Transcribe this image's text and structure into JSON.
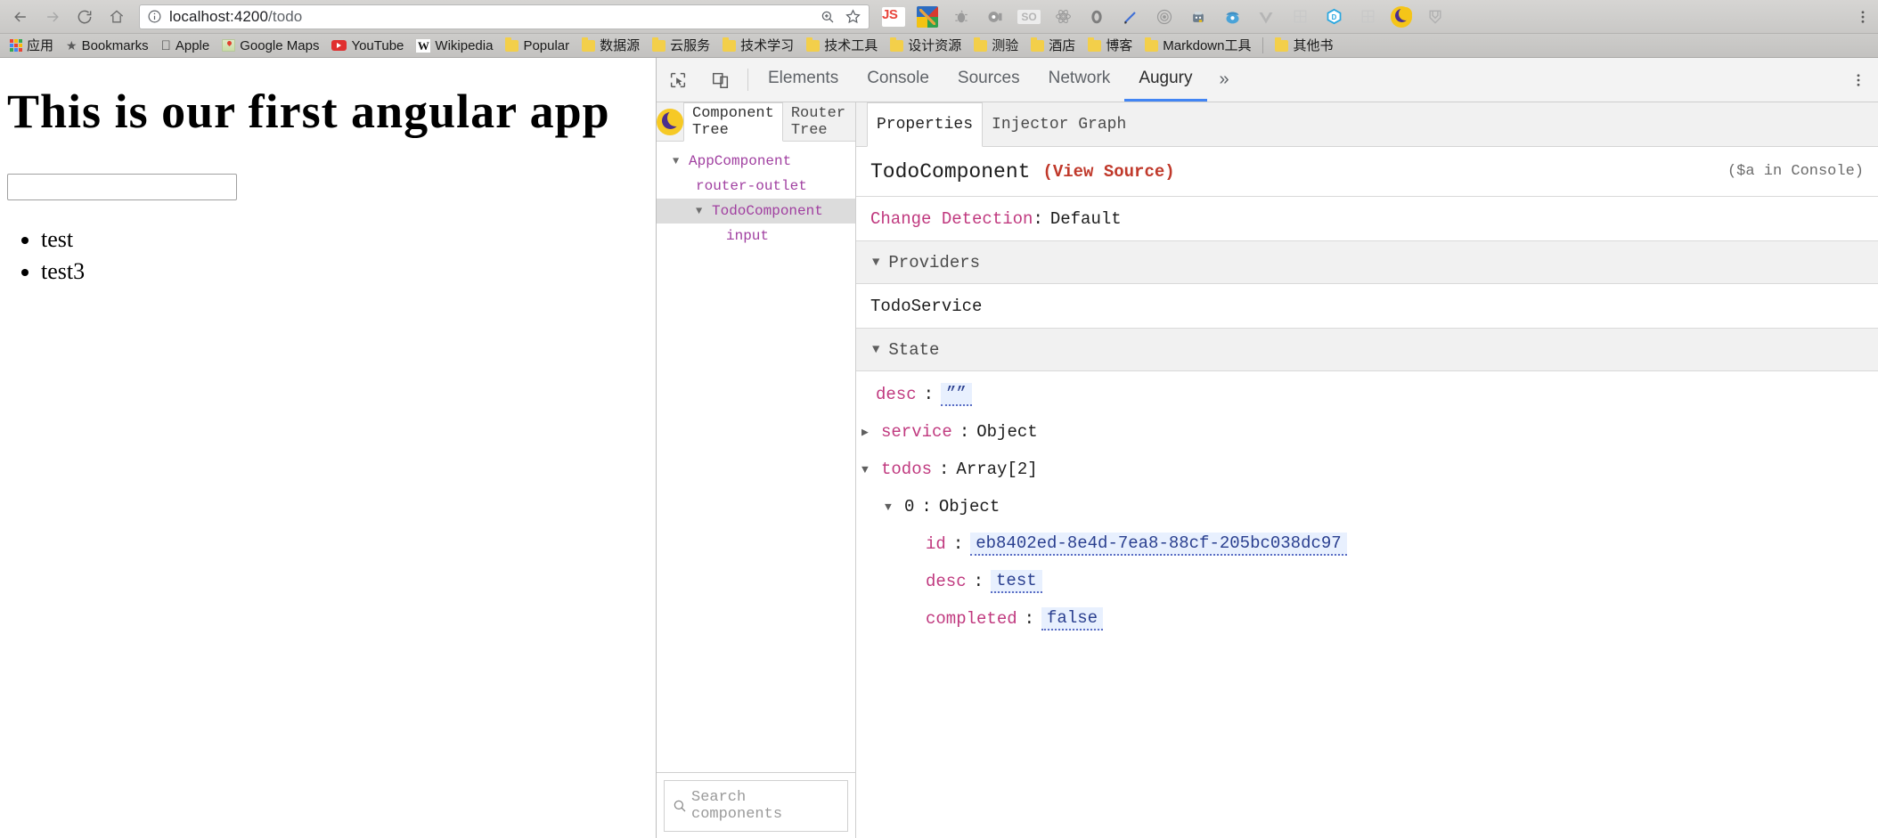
{
  "browser": {
    "nav": {
      "back": "back-arrow",
      "forward": "forward-arrow",
      "reload": "reload",
      "home": "home"
    },
    "url": {
      "host": "localhost:4200",
      "path": "/todo",
      "full": "localhost:4200/todo"
    },
    "omnibox_actions": [
      "zoom-icon",
      "bookmark-star-icon"
    ],
    "extensions": [
      "JS",
      "paint-icon",
      "bug-icon",
      "film-icon",
      "SO",
      "react-icon",
      "ring-icon",
      "pen-icon",
      "target-icon",
      "robot-icon",
      "detective-icon",
      "vue-icon",
      "grid-icon",
      "dimensions-icon",
      "grid2-icon",
      "moon-icon",
      "shield-icon"
    ],
    "menu": "chrome-menu-icon"
  },
  "bookmarks": [
    {
      "label": "应用",
      "icon": "apps-grid-icon"
    },
    {
      "label": "Bookmarks",
      "icon": "star-icon"
    },
    {
      "label": "Apple",
      "icon": "apple-icon"
    },
    {
      "label": "Google Maps",
      "icon": "map-icon"
    },
    {
      "label": "YouTube",
      "icon": "youtube-icon"
    },
    {
      "label": "Wikipedia",
      "icon": "wikipedia-icon"
    },
    {
      "label": "Popular",
      "icon": "folder-icon"
    },
    {
      "label": "数据源",
      "icon": "folder-icon"
    },
    {
      "label": "云服务",
      "icon": "folder-icon"
    },
    {
      "label": "技术学习",
      "icon": "folder-icon"
    },
    {
      "label": "技术工具",
      "icon": "folder-icon"
    },
    {
      "label": "设计资源",
      "icon": "folder-icon"
    },
    {
      "label": "测验",
      "icon": "folder-icon"
    },
    {
      "label": "酒店",
      "icon": "folder-icon"
    },
    {
      "label": "博客",
      "icon": "folder-icon"
    },
    {
      "label": "Markdown工具",
      "icon": "folder-icon"
    },
    {
      "label": "其他书",
      "icon": "folder-icon"
    }
  ],
  "page": {
    "heading": "This is our first angular app",
    "input_value": "",
    "input_placeholder": "",
    "todos": [
      "test",
      "test3"
    ]
  },
  "devtools": {
    "tabs": [
      {
        "label": "Elements",
        "active": false
      },
      {
        "label": "Console",
        "active": false
      },
      {
        "label": "Sources",
        "active": false
      },
      {
        "label": "Network",
        "active": false
      },
      {
        "label": "Augury",
        "active": true
      }
    ],
    "more": "»",
    "tools": [
      "inspect-element-icon",
      "device-toolbar-icon"
    ],
    "menu": "kebab-menu-icon"
  },
  "augury": {
    "logo": "augury-moon-logo",
    "tree_tabs": [
      {
        "label": "Component Tree",
        "active": true
      },
      {
        "label": "Router Tree",
        "active": false
      }
    ],
    "tree": [
      {
        "label": "AppComponent",
        "caret": "▼",
        "depth": 0,
        "selected": false
      },
      {
        "label": "router-outlet",
        "caret": "",
        "depth": 1,
        "selected": false
      },
      {
        "label": "TodoComponent",
        "caret": "▼",
        "depth": 1,
        "selected": true
      },
      {
        "label": "input",
        "caret": "",
        "depth": 2,
        "selected": false
      }
    ],
    "search": {
      "placeholder": "Search components",
      "icon": "search-icon"
    },
    "prop_tabs": [
      {
        "label": "Properties",
        "active": true
      },
      {
        "label": "Injector Graph",
        "active": false
      }
    ],
    "component": {
      "name": "TodoComponent",
      "view_source": "(View Source)",
      "console_hint": "($a in Console)"
    },
    "change_detection": {
      "key": "Change Detection",
      "sep": ":",
      "value": "Default"
    },
    "providers": {
      "title": "Providers",
      "caret": "▼",
      "items": [
        "TodoService"
      ]
    },
    "state": {
      "title": "State",
      "caret": "▼",
      "rows": [
        {
          "caret": "",
          "key": "desc",
          "sep": ":",
          "value": "””",
          "chip": true,
          "depth": 1
        },
        {
          "caret": "▶",
          "key": "service",
          "sep": ":",
          "value": "Object",
          "chip": false,
          "depth": 0
        },
        {
          "caret": "▼",
          "key": "todos",
          "sep": ":",
          "value": "Array[2]",
          "chip": false,
          "depth": 0
        },
        {
          "caret": "▼",
          "key": "0",
          "sep": ":",
          "value": "Object",
          "chip": false,
          "depth": 1,
          "plainkey": true
        },
        {
          "caret": "",
          "key": "id",
          "sep": ":",
          "value": "eb8402ed-8e4d-7ea8-88cf-205bc038dc97",
          "chip": true,
          "depth": 3
        },
        {
          "caret": "",
          "key": "desc",
          "sep": ":",
          "value": "test",
          "chip": true,
          "depth": 3
        },
        {
          "caret": "",
          "key": "completed",
          "sep": ":",
          "value": "false",
          "chip": true,
          "depth": 3
        }
      ]
    }
  },
  "colors": {
    "accent": "#4285f4",
    "tree_node": "#a03fa0",
    "key_pink": "#c0397f",
    "view_source_red": "#c0392b",
    "chip_bg": "#e8f0fe",
    "chip_text": "#2a3f8f",
    "augury_yellow": "#f6c925",
    "augury_purple": "#4b2e8e"
  }
}
